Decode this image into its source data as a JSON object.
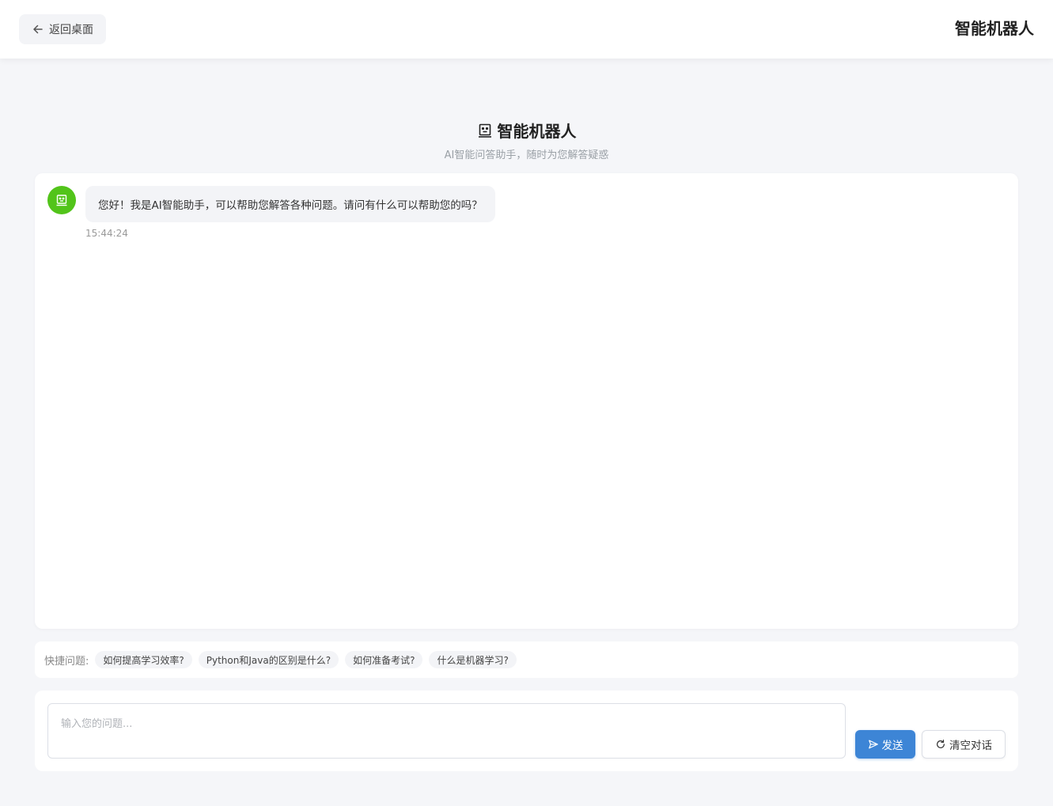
{
  "topbar": {
    "back_label": "返回桌面",
    "title": "智能机器人"
  },
  "header": {
    "title": "智能机器人",
    "subtitle": "AI智能问答助手，随时为您解答疑惑"
  },
  "messages": [
    {
      "role": "bot",
      "text": "您好！我是AI智能助手，可以帮助您解答各种问题。请问有什么可以帮助您的吗？",
      "time": "15:44:24"
    }
  ],
  "quick": {
    "label": "快捷问题:",
    "items": [
      "如何提高学习效率?",
      "Python和Java的区别是什么?",
      "如何准备考试?",
      "什么是机器学习?"
    ]
  },
  "input": {
    "placeholder": "输入您的问题...",
    "value": ""
  },
  "actions": {
    "send_label": "发送",
    "clear_label": "清空对话"
  },
  "colors": {
    "accent": "#3d85d6",
    "avatar": "#52c41a",
    "background": "#f5f6f9"
  },
  "icons": {
    "back": "arrow-left-icon",
    "robot": "robot-icon",
    "send": "send-icon",
    "clear": "refresh-icon"
  }
}
